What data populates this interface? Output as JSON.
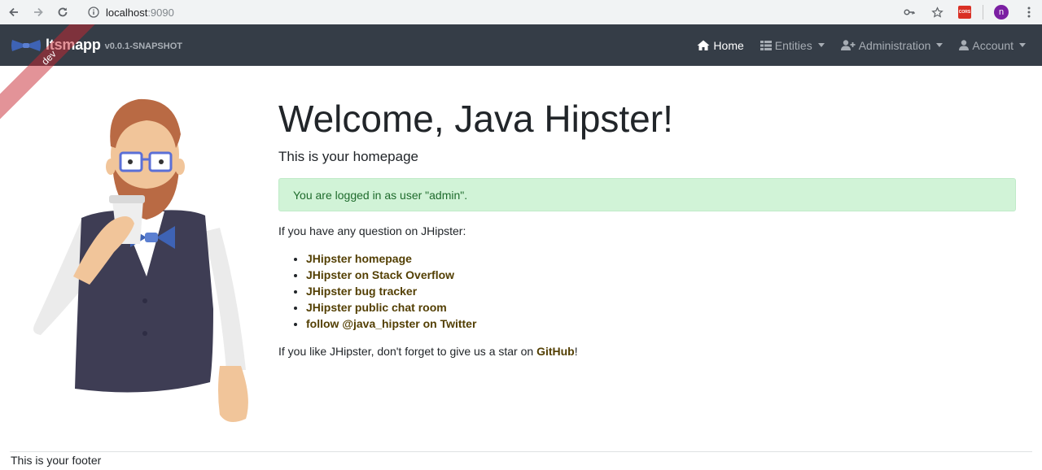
{
  "browser": {
    "url_host": "localhost",
    "url_port": ":9090",
    "extension_badge": "CORS",
    "profile_initial": "n"
  },
  "navbar": {
    "brand_name": "ltsmapp",
    "brand_version": "v0.0.1-SNAPSHOT",
    "items": [
      {
        "label": "Home"
      },
      {
        "label": "Entities"
      },
      {
        "label": "Administration"
      },
      {
        "label": "Account"
      }
    ]
  },
  "ribbon": {
    "label": "dev"
  },
  "main": {
    "title": "Welcome, Java Hipster!",
    "subtitle": "This is your homepage",
    "alert": "You are logged in as user \"admin\".",
    "question": "If you have any question on JHipster:",
    "links": [
      {
        "label": "JHipster homepage"
      },
      {
        "label": "JHipster on Stack Overflow"
      },
      {
        "label": "JHipster bug tracker"
      },
      {
        "label": "JHipster public chat room"
      },
      {
        "label": "follow @java_hipster on Twitter"
      }
    ],
    "star_prefix": "If you like JHipster, don't forget to give us a star on ",
    "star_link": "GitHub",
    "star_suffix": "!"
  },
  "footer": {
    "text": "This is your footer"
  },
  "colors": {
    "navbar_bg": "#353d47",
    "alert_bg": "#d1f3d7",
    "link": "#533f03"
  }
}
